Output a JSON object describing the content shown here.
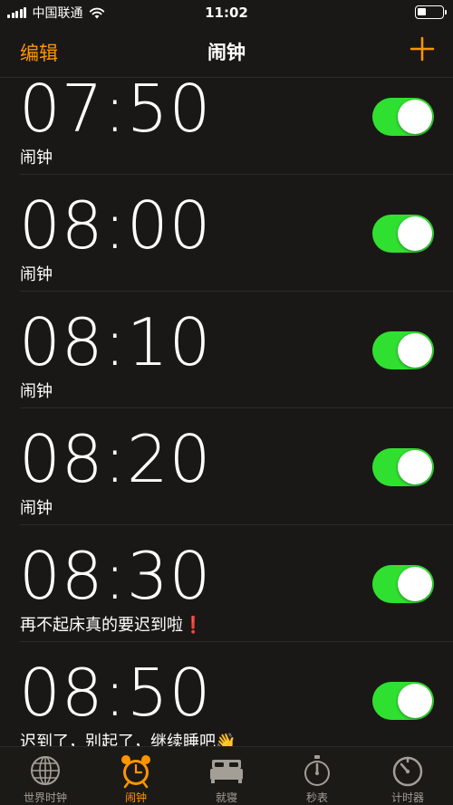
{
  "status_bar": {
    "carrier": "中国联通",
    "time": "11:02",
    "battery_level": 0.35
  },
  "nav": {
    "edit_label": "编辑",
    "title": "闹钟",
    "add_icon": "plus-icon"
  },
  "alarms": [
    {
      "time": "07:50",
      "label": "闹钟",
      "enabled": true
    },
    {
      "time": "08:00",
      "label": "闹钟",
      "enabled": true
    },
    {
      "time": "08:10",
      "label": "闹钟",
      "enabled": true
    },
    {
      "time": "08:20",
      "label": "闹钟",
      "enabled": true
    },
    {
      "time": "08:30",
      "label": "再不起床真的要迟到啦❗",
      "enabled": true
    },
    {
      "time": "08:50",
      "label": "迟到了，别起了，继续睡吧👋",
      "enabled": true
    }
  ],
  "tabs": [
    {
      "label": "世界时钟",
      "icon": "globe-icon",
      "active": false
    },
    {
      "label": "闹钟",
      "icon": "alarm-clock-icon",
      "active": true
    },
    {
      "label": "就寝",
      "icon": "bed-icon",
      "active": false
    },
    {
      "label": "秒表",
      "icon": "stopwatch-icon",
      "active": false
    },
    {
      "label": "计时器",
      "icon": "timer-icon",
      "active": false
    }
  ],
  "colors": {
    "accent": "#ff9500",
    "toggle_on": "#30e030",
    "background": "#1a1816",
    "tab_inactive": "#a39e96"
  }
}
